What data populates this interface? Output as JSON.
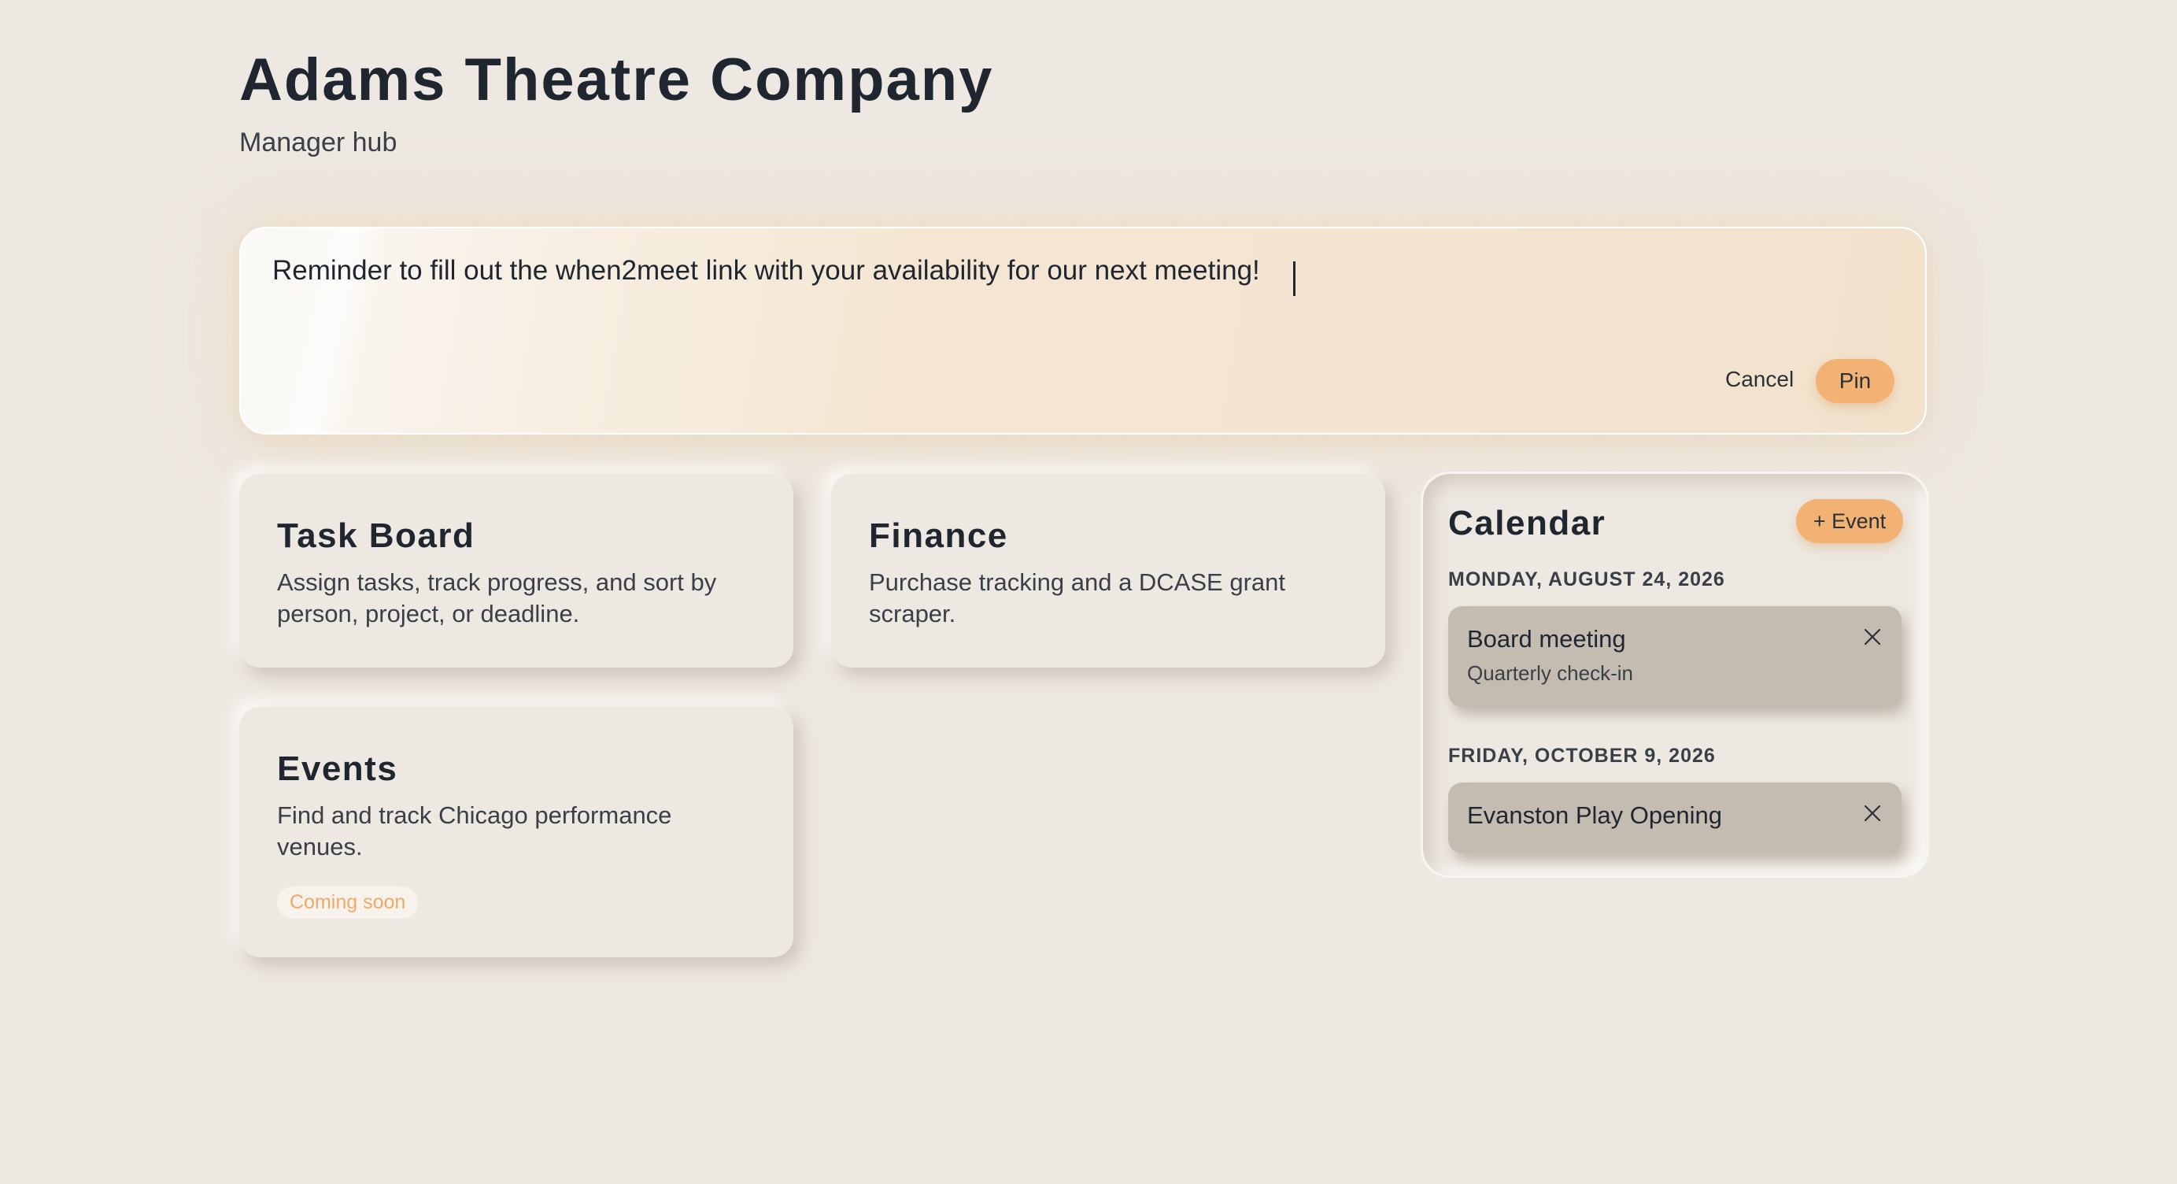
{
  "header": {
    "title": "Adams Theatre Company",
    "subtitle": "Manager hub"
  },
  "pin_composer": {
    "text": "Reminder to fill out the when2meet link with your availability for our next meeting!",
    "cancel_label": "Cancel",
    "pin_label": "Pin"
  },
  "cards": {
    "task_board": {
      "title": "Task Board",
      "description": "Assign tasks, track progress, and sort by person, project, or deadline."
    },
    "finance": {
      "title": "Finance",
      "description": "Purchase tracking and a DCASE grant scraper."
    },
    "events": {
      "title": "Events",
      "description": "Find and track Chicago performance venues.",
      "badge": "Coming soon"
    }
  },
  "calendar": {
    "title": "Calendar",
    "add_event_label": "+ Event",
    "groups": [
      {
        "date": "MONDAY, AUGUST 24, 2026",
        "events": [
          {
            "title": "Board meeting",
            "subtitle": "Quarterly check-in",
            "close_icon": "close-icon"
          }
        ]
      },
      {
        "date": "FRIDAY, OCTOBER 9, 2026",
        "events": [
          {
            "title": "Evanston Play Opening",
            "close_icon": "close-icon"
          }
        ]
      }
    ]
  },
  "colors": {
    "background": "#ede8e1",
    "accent": "#f1b274",
    "text": "#1f2630",
    "event_chip": "#c5bcb1",
    "badge_text": "#eea968"
  }
}
